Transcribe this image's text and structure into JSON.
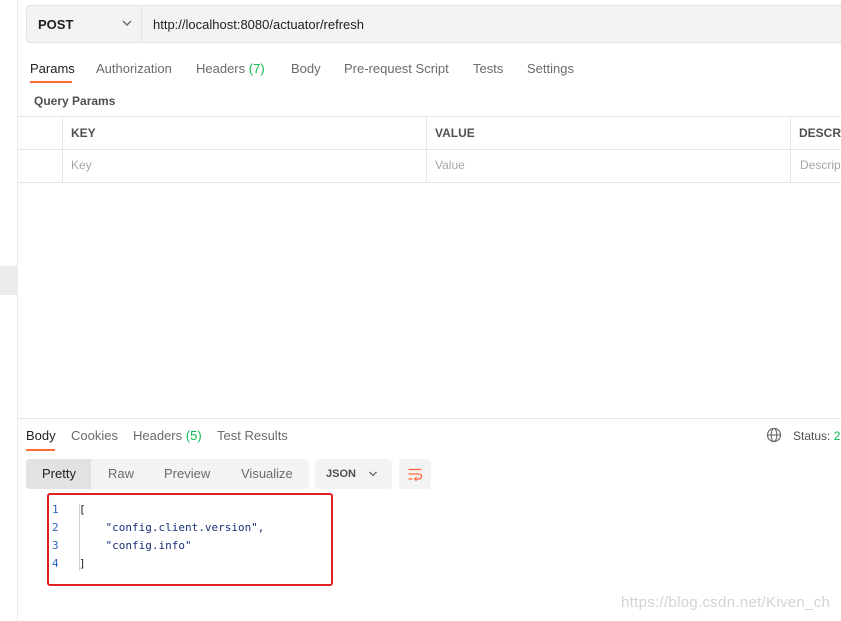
{
  "request": {
    "method": "POST",
    "url": "http://localhost:8080/actuator/refresh"
  },
  "tabs": [
    {
      "label": "Params"
    },
    {
      "label": "Authorization"
    },
    {
      "label": "Headers",
      "count": "(7)"
    },
    {
      "label": "Body"
    },
    {
      "label": "Pre-request Script"
    },
    {
      "label": "Tests"
    },
    {
      "label": "Settings"
    }
  ],
  "query_params": {
    "title": "Query Params",
    "headers": [
      "KEY",
      "VALUE",
      "DESCRI"
    ],
    "placeholders": [
      "Key",
      "Value",
      "Descrip"
    ]
  },
  "response": {
    "tabs": [
      {
        "label": "Body"
      },
      {
        "label": "Cookies"
      },
      {
        "label": "Headers",
        "count": "(5)"
      },
      {
        "label": "Test Results"
      }
    ],
    "status_label": "Status:",
    "status_value": "2",
    "views": [
      "Pretty",
      "Raw",
      "Preview",
      "Visualize"
    ],
    "format": "JSON",
    "line_numbers": [
      "1",
      "2",
      "3",
      "4"
    ],
    "code_lines": [
      "[",
      "    \"config.client.version\",",
      "    \"config.info\"",
      "]"
    ]
  },
  "watermark": "https://blog.csdn.net/Kiven_ch",
  "colors": {
    "accent": "#ff6c37",
    "count_green": "#0cbb52",
    "highlight_red": "#e02020"
  },
  "icons": [
    "chevron-down-icon",
    "globe-icon",
    "wrap-lines-icon"
  ]
}
